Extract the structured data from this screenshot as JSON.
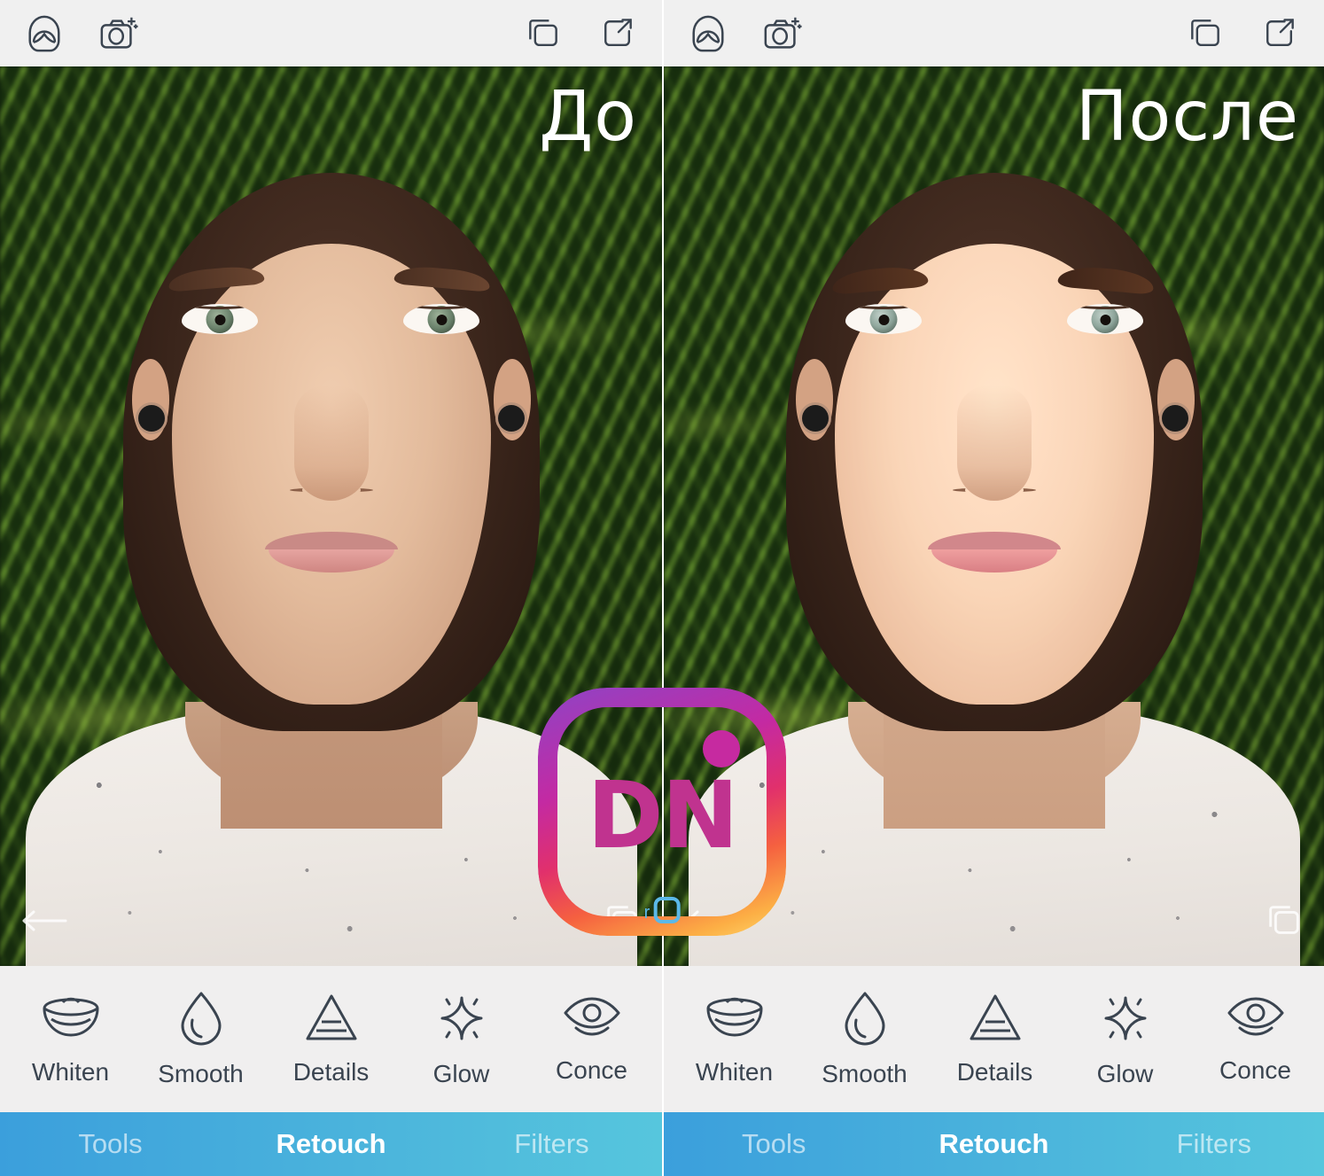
{
  "app": {
    "brand_face": "face",
    "brand_tune": "tune"
  },
  "topbar": {
    "icons_left": [
      {
        "name": "portrait-face-icon",
        "label": "Portrait"
      },
      {
        "name": "camera-magic-icon",
        "label": "Camera"
      }
    ],
    "icons_right": [
      {
        "name": "compare-layers-icon",
        "label": "Compare"
      },
      {
        "name": "share-export-icon",
        "label": "Share"
      }
    ]
  },
  "panels": [
    {
      "id": "before",
      "overlay_label": "До",
      "photo_alt": "Портрет девушки на фоне пальмовых листьев, до ретуши"
    },
    {
      "id": "after",
      "overlay_label": "После",
      "photo_alt": "Портрет девушки на фоне пальмовых листьев, после ретуши"
    }
  ],
  "photo_controls": {
    "undo": "undo-arrow",
    "redo": "redo-arrow",
    "compare": "compare-layers"
  },
  "tools": [
    {
      "label": "Whiten",
      "icon": "smile-teeth-icon"
    },
    {
      "label": "Smooth",
      "icon": "water-drop-icon"
    },
    {
      "label": "Details",
      "icon": "triangle-layers-icon"
    },
    {
      "label": "Glow",
      "icon": "sparkle-icon"
    },
    {
      "label": "Conce",
      "icon": "eye-icon"
    }
  ],
  "nav": {
    "items": [
      {
        "label": "Tools",
        "active": false
      },
      {
        "label": "Retouch",
        "active": true
      },
      {
        "label": "Filters",
        "active": false
      }
    ]
  },
  "watermark": {
    "text": "DN",
    "sub": "r",
    "dot": "dot"
  },
  "colors": {
    "brand_red": "#ef4136",
    "brand_blue": "#5bc0f0",
    "topbar_bg": "#f0f0f0",
    "toolstrip_bg": "#f0efef",
    "icon_stroke": "#3a4450",
    "nav_gradient_start": "#3b9fdc",
    "nav_gradient_end": "#56c6dd",
    "watermark_magenta": "#c0338f"
  }
}
